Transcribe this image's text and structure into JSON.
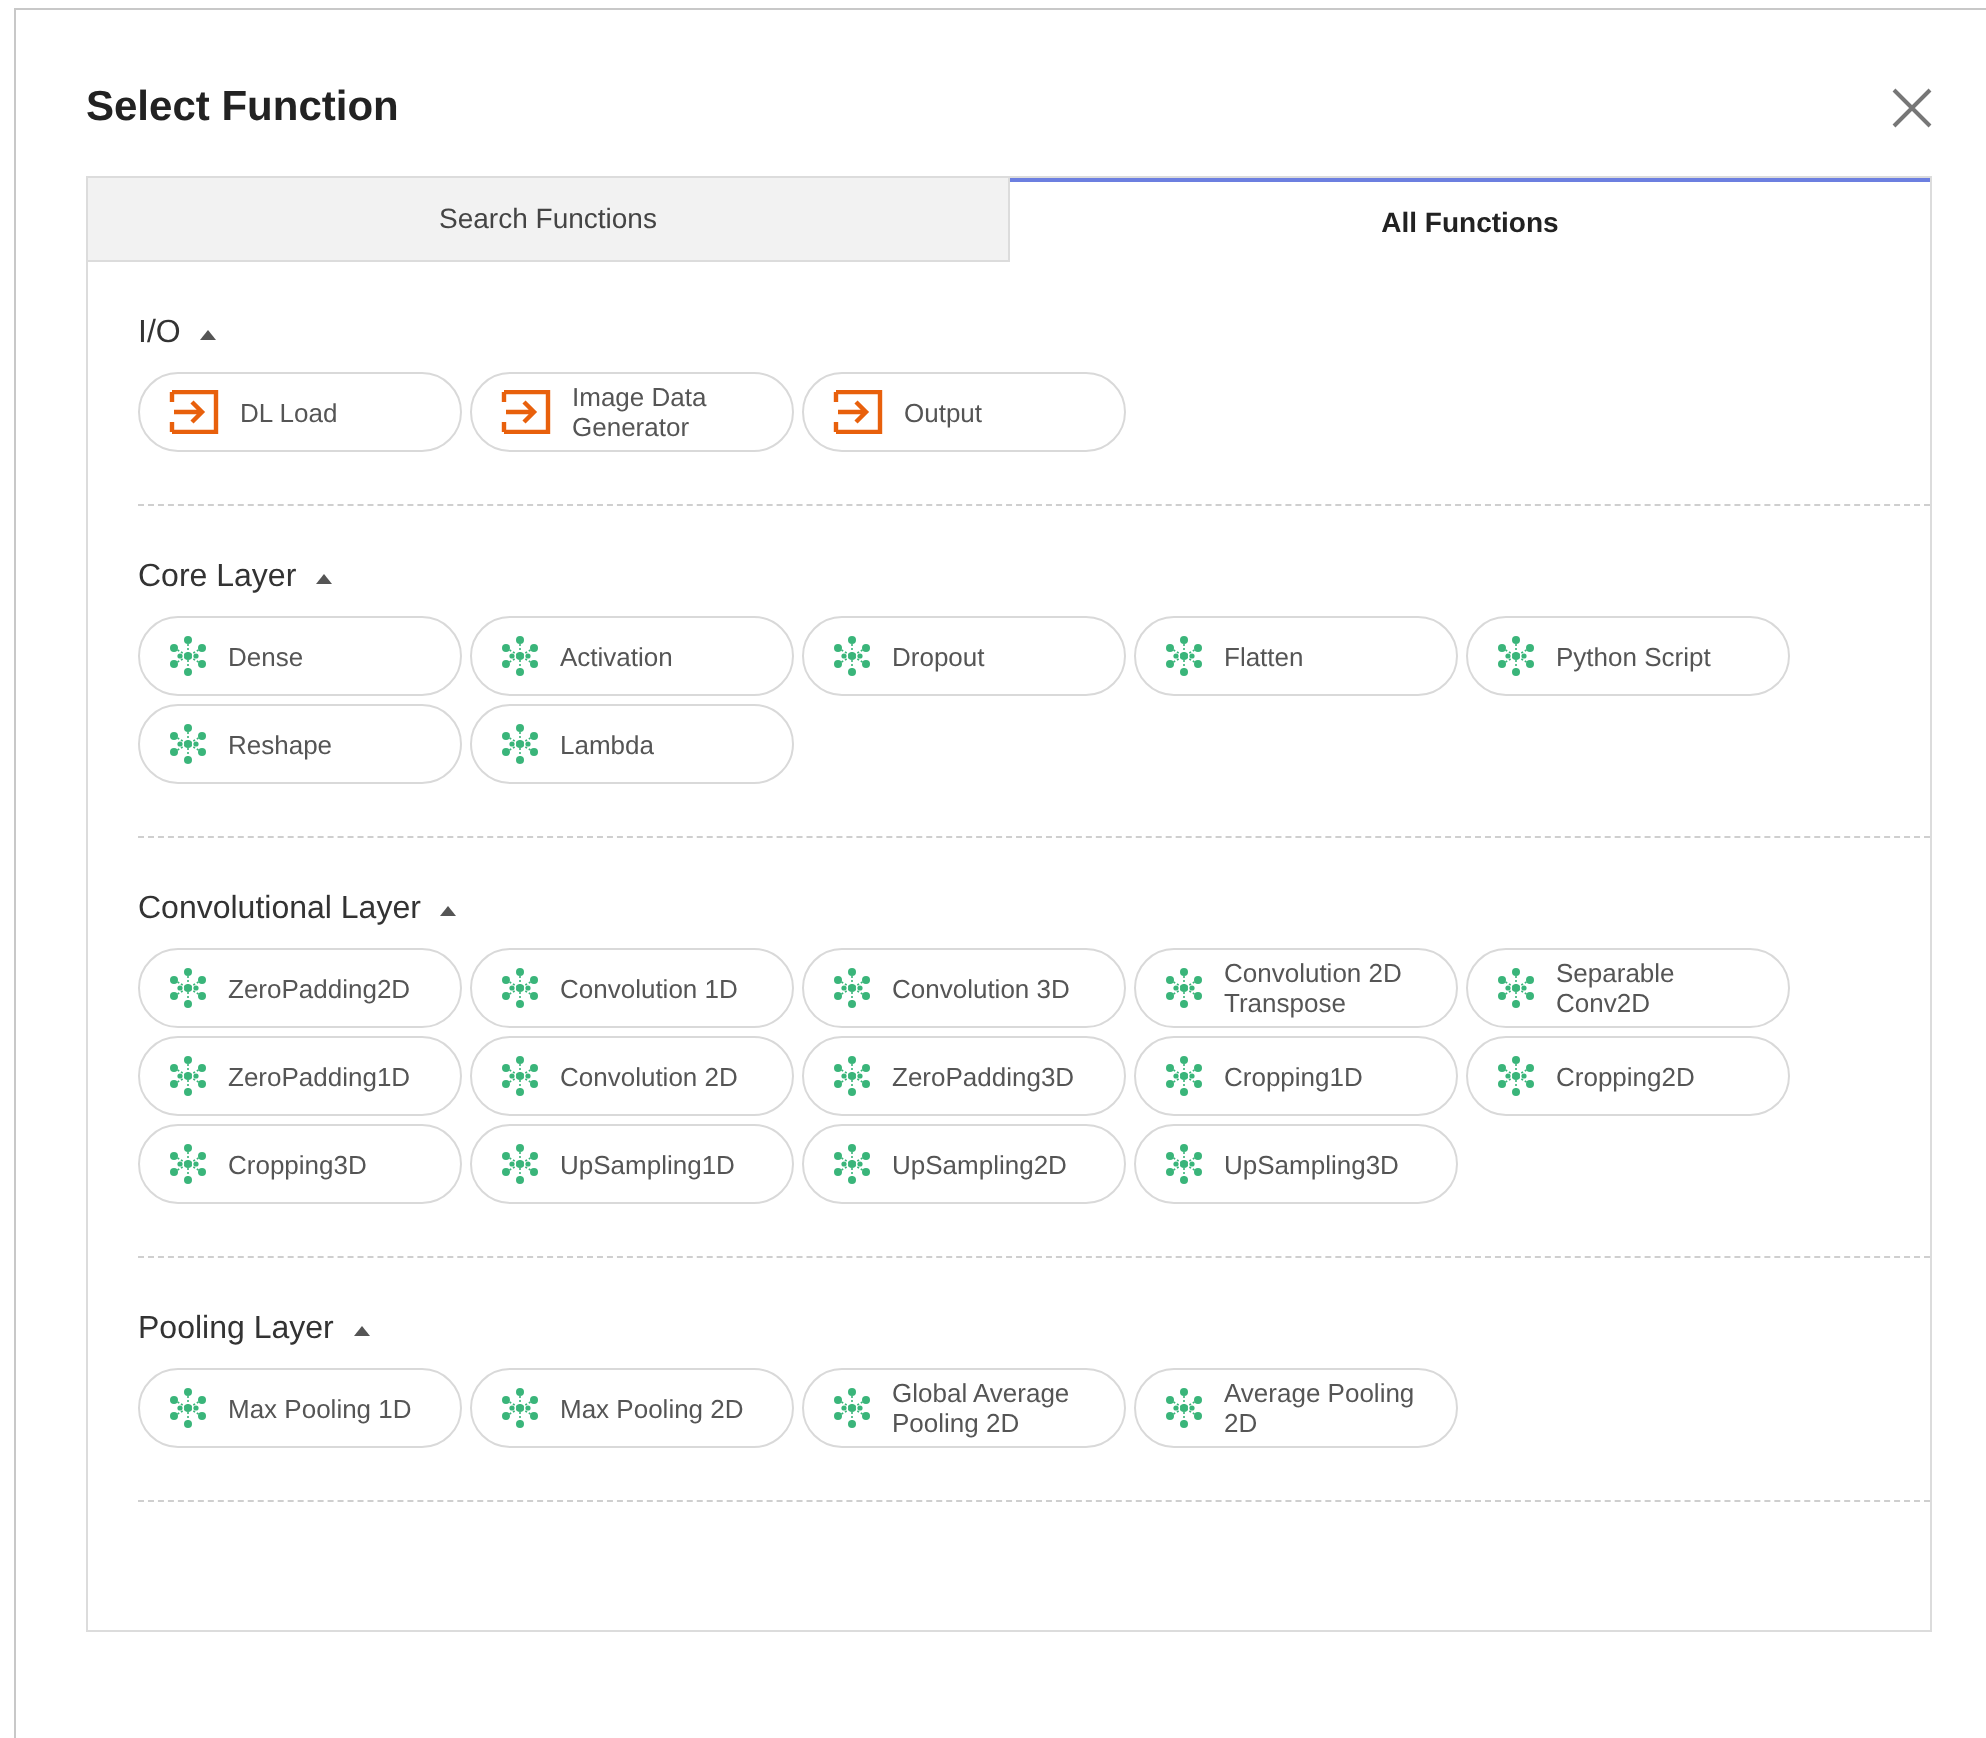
{
  "dialog": {
    "title": "Select Function"
  },
  "tabs": [
    {
      "label": "Search Functions",
      "selected": false
    },
    {
      "label": "All Functions",
      "selected": true
    }
  ],
  "sections": [
    {
      "title": "I/O",
      "expanded": true,
      "items": [
        {
          "label": "DL Load",
          "kind": "io"
        },
        {
          "label": "Image Data Generator",
          "kind": "io"
        },
        {
          "label": "Output",
          "kind": "io"
        }
      ]
    },
    {
      "title": "Core Layer",
      "expanded": true,
      "items": [
        {
          "label": "Dense",
          "kind": "layer"
        },
        {
          "label": "Activation",
          "kind": "layer"
        },
        {
          "label": "Dropout",
          "kind": "layer"
        },
        {
          "label": "Flatten",
          "kind": "layer"
        },
        {
          "label": "Python Script",
          "kind": "layer"
        },
        {
          "label": "Reshape",
          "kind": "layer"
        },
        {
          "label": "Lambda",
          "kind": "layer"
        }
      ]
    },
    {
      "title": "Convolutional Layer",
      "expanded": true,
      "items": [
        {
          "label": "ZeroPadding2D",
          "kind": "layer"
        },
        {
          "label": "Convolution 1D",
          "kind": "layer"
        },
        {
          "label": "Convolution 3D",
          "kind": "layer"
        },
        {
          "label": "Convolution 2D Transpose",
          "kind": "layer"
        },
        {
          "label": "Separable Conv2D",
          "kind": "layer"
        },
        {
          "label": "ZeroPadding1D",
          "kind": "layer"
        },
        {
          "label": "Convolution 2D",
          "kind": "layer"
        },
        {
          "label": "ZeroPadding3D",
          "kind": "layer"
        },
        {
          "label": "Cropping1D",
          "kind": "layer"
        },
        {
          "label": "Cropping2D",
          "kind": "layer"
        },
        {
          "label": "Cropping3D",
          "kind": "layer"
        },
        {
          "label": "UpSampling1D",
          "kind": "layer"
        },
        {
          "label": "UpSampling2D",
          "kind": "layer"
        },
        {
          "label": "UpSampling3D",
          "kind": "layer"
        }
      ]
    },
    {
      "title": "Pooling Layer",
      "expanded": true,
      "items": [
        {
          "label": "Max Pooling 1D",
          "kind": "layer"
        },
        {
          "label": "Max Pooling 2D",
          "kind": "layer"
        },
        {
          "label": "Global Average Pooling 2D",
          "kind": "layer"
        },
        {
          "label": "Average Pooling 2D",
          "kind": "layer"
        }
      ]
    }
  ]
}
